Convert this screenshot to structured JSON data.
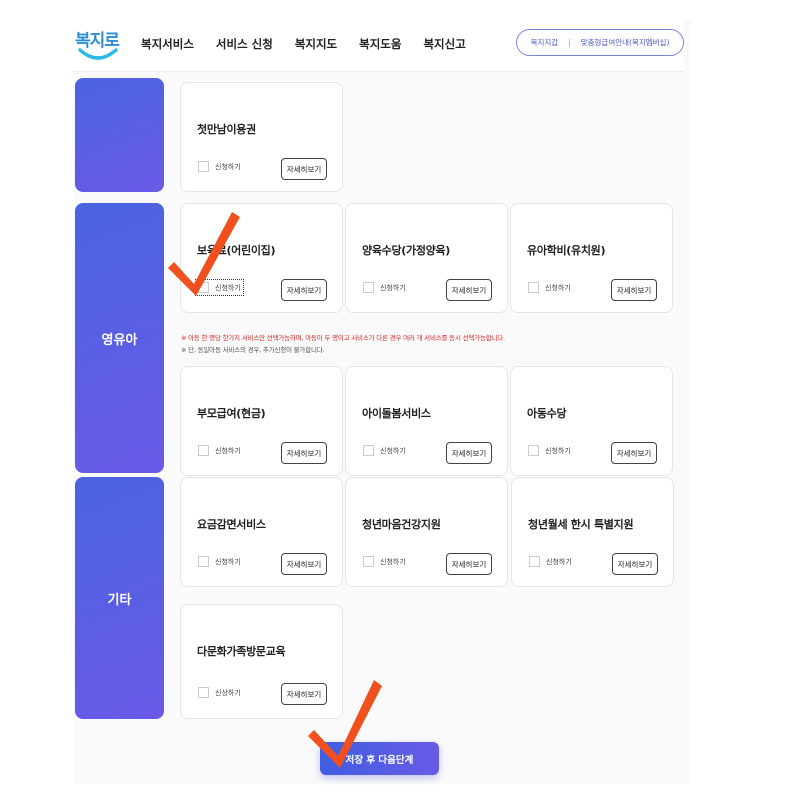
{
  "header": {
    "logo_text": "복지로",
    "nav": [
      "복지서비스",
      "서비스 신청",
      "복지지도",
      "복지도움",
      "복지신고"
    ],
    "util_links": [
      "복지지갑",
      "맞춤형급여안내(복지멤버십)"
    ]
  },
  "categories": [
    {
      "label": ""
    },
    {
      "label": "영유아"
    },
    {
      "label": "기타"
    }
  ],
  "cards": [
    {
      "title": "첫만남이용권",
      "apply_label": "신청하기",
      "detail_label": "자세히보기"
    },
    {
      "title": "보육료(어린이집)",
      "apply_label": "신청하기",
      "detail_label": "자세히보기"
    },
    {
      "title": "양육수당(가정양육)",
      "apply_label": "신청하기",
      "detail_label": "자세히보기"
    },
    {
      "title": "유아학비(유치원)",
      "apply_label": "신청하기",
      "detail_label": "자세히보기"
    },
    {
      "title": "부모급여(현금)",
      "apply_label": "신청하기",
      "detail_label": "자세히보기"
    },
    {
      "title": "아이돌봄서비스",
      "apply_label": "신청하기",
      "detail_label": "자세히보기"
    },
    {
      "title": "아동수당",
      "apply_label": "신청하기",
      "detail_label": "자세히보기"
    },
    {
      "title": "요금감면서비스",
      "apply_label": "신청하기",
      "detail_label": "자세히보기"
    },
    {
      "title": "청년마음건강지원",
      "apply_label": "신청하기",
      "detail_label": "자세히보기"
    },
    {
      "title": "청년월세 한시 특별지원",
      "apply_label": "신청하기",
      "detail_label": "자세히보기"
    },
    {
      "title": "다문화가족방문교육",
      "apply_label": "신상하기",
      "detail_label": "자세히보기"
    }
  ],
  "notices": [
    "※ 아동 한 명당 한가지 서비스만 선택가능하며, 아동이 두 명이고 서비스가 다른 경우 여러 개 서비스를 동시 선택가능합니다.",
    "※ 단, 동일아동 서비스의 경우, 추가신청이 불가합니다."
  ],
  "save_button": "저장 후 다음단계",
  "colors": {
    "accent": "#4b57c9",
    "category_gradient_start": "#4a63e0",
    "category_gradient_end": "#6a5ae6",
    "check_mark": "#f0501e",
    "notice_red": "#d42a2a"
  }
}
